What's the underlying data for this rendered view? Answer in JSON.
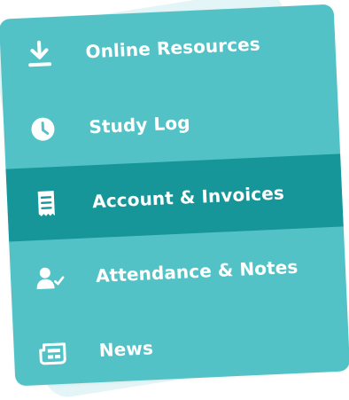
{
  "menu": {
    "items": [
      {
        "label": "Online Resources",
        "icon": "download-icon",
        "active": false
      },
      {
        "label": "Study Log",
        "icon": "clock-icon",
        "active": false
      },
      {
        "label": "Account & Invoices",
        "icon": "receipt-icon",
        "active": true
      },
      {
        "label": "Attendance & Notes",
        "icon": "user-check-icon",
        "active": false
      },
      {
        "label": "News",
        "icon": "newspaper-icon",
        "active": false
      }
    ]
  },
  "colors": {
    "page_background": "#ffffff",
    "backdrop": "#e3f5f6",
    "card": "#52c2c6",
    "active_item": "#17969a",
    "text": "#ffffff"
  }
}
